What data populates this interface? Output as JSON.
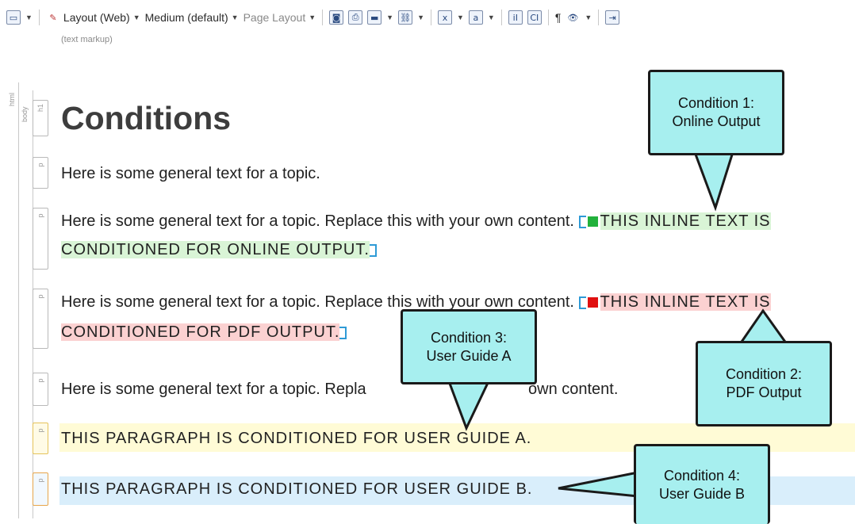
{
  "toolbar": {
    "layout_label": "Layout (Web)",
    "medium_label": "Medium (default)",
    "page_layout_label": "Page Layout",
    "markup_mode": "(text markup)",
    "pilcrow": "¶"
  },
  "structure": {
    "html_label": "html",
    "body_label": "body",
    "h1_label": "h1",
    "p_label": "p"
  },
  "document": {
    "heading": "Conditions",
    "para1": "Here is some general text for a topic.",
    "para2_text": "Here is some general text for a topic. Replace this with your own content.",
    "para2_cond_a": "THIS INLINE TEXT IS",
    "para2_cond_b": "CONDITIONED FOR ONLINE OUTPUT.",
    "para3_text": "Here is some general text for a topic. Replace this with your own content.",
    "para3_cond_a": "THIS INLINE TEXT IS",
    "para3_cond_b": "CONDITIONED FOR PDF OUTPUT.",
    "para4_left": "Here is some general text for a topic. Repla",
    "para4_right": "own content.",
    "para5": "THIS PARAGRAPH IS CONDITIONED FOR USER GUIDE A.",
    "para6": "THIS PARAGRAPH IS CONDITIONED FOR USER GUIDE B."
  },
  "callouts": {
    "c1_line1": "Condition 1:",
    "c1_line2": "Online Output",
    "c2_line1": "Condition 2:",
    "c2_line2": "PDF Output",
    "c3_line1": "Condition 3:",
    "c3_line2": "User Guide A",
    "c4_line1": "Condition 4:",
    "c4_line2": "User Guide B"
  },
  "colors": {
    "online": "#22b13c",
    "pdf": "#e01010",
    "callout_fill": "#a7efef",
    "guide_a_bg": "#fffbd6",
    "guide_b_bg": "#d9eefb"
  },
  "icons": [
    "view-icon",
    "layout-icon",
    "preview-icon",
    "print-icon",
    "image-icon",
    "link-icon",
    "snippet-icon",
    "variable-icon",
    "insert-icon",
    "condition-icon",
    "pilcrow-icon",
    "show-icon",
    "jump-icon"
  ]
}
